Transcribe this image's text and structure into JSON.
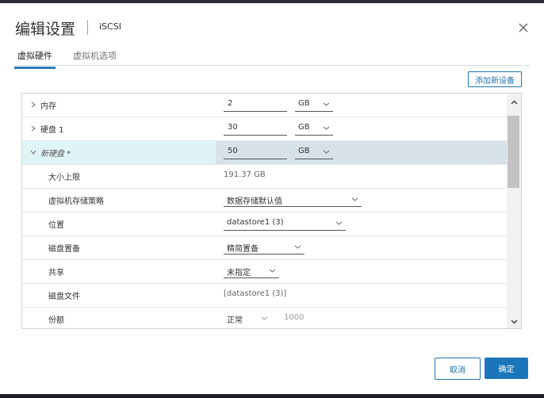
{
  "dialog": {
    "title": "编辑设置",
    "subtitle": "iSCSI"
  },
  "tabs": [
    {
      "label": "虚拟硬件"
    },
    {
      "label": "虚拟机选项"
    }
  ],
  "add_device_label": "添加新设备",
  "hardware": {
    "memory": {
      "label": "内存",
      "value": "2",
      "unit": "GB"
    },
    "disk1": {
      "label": "硬盘 1",
      "value": "30",
      "unit": "GB"
    },
    "new_disk": {
      "label": "新硬盘 *",
      "value": "50",
      "unit": "GB",
      "max_size_label": "大小上限",
      "max_size_value": "191.37 GB",
      "policy_label": "虚拟机存储策略",
      "policy_value": "数据存储默认值",
      "location_label": "位置",
      "location_value": "datastore1 (3)",
      "provisioning_label": "磁盘置备",
      "provisioning_value": "精简置备",
      "sharing_label": "共享",
      "sharing_value": "未指定",
      "file_label": "磁盘文件",
      "file_value": "[datastore1 (3)]",
      "shares_label": "份额",
      "shares_level": "正常",
      "shares_value": "1000"
    }
  },
  "footer": {
    "cancel_label": "取消",
    "ok_label": "确定"
  },
  "colors": {
    "accent": "#1b75bb",
    "selected_row": "#dff5f5"
  }
}
